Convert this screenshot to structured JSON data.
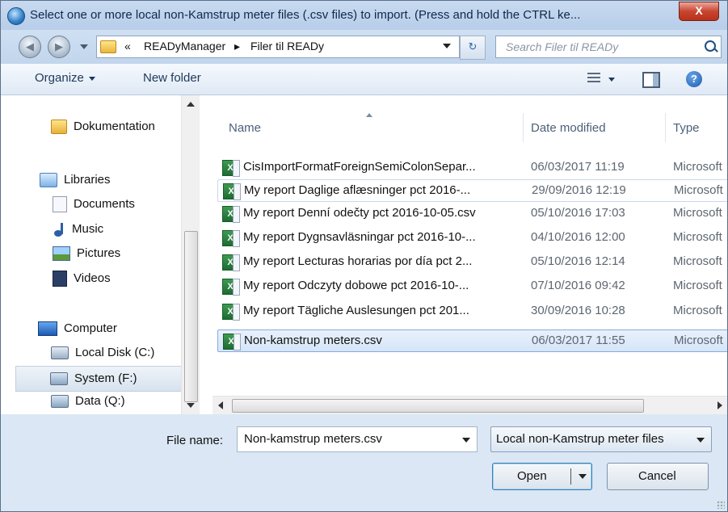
{
  "window": {
    "title": "Select one or more local non-Kamstrup meter files (.csv files) to import. (Press and hold the CTRL ke...",
    "close_glyph": "X"
  },
  "address": {
    "overflow": "«",
    "crumb1": "READyManager",
    "sep": "▸",
    "crumb2": "Filer til READy",
    "refresh_glyph": "↻",
    "search_placeholder": "Search Filer til READy"
  },
  "toolbar": {
    "organize": "Organize",
    "new_folder": "New folder",
    "help_glyph": "?"
  },
  "nav": {
    "items": [
      {
        "label": "Dokumentation",
        "icon": "folder-icon"
      },
      {
        "label": "Libraries",
        "icon": "libraries-icon"
      },
      {
        "label": "Documents",
        "icon": "documents-icon"
      },
      {
        "label": "Music",
        "icon": "music-icon"
      },
      {
        "label": "Pictures",
        "icon": "pictures-icon"
      },
      {
        "label": "Videos",
        "icon": "videos-icon"
      },
      {
        "label": "Computer",
        "icon": "computer-icon"
      },
      {
        "label": "Local Disk (C:)",
        "icon": "local-disk-icon"
      },
      {
        "label": "System (F:)",
        "icon": "network-drive-icon"
      },
      {
        "label": "Data (Q:)",
        "icon": "network-drive-icon"
      }
    ],
    "selected": "System (F:)"
  },
  "columns": {
    "name": "Name",
    "date": "Date modified",
    "type": "Type"
  },
  "files": [
    {
      "name": "CisImportFormatForeignSemiColonSepar...",
      "date": "06/03/2017 11:19",
      "type": "Microsoft",
      "icon": "excel-csv-icon"
    },
    {
      "name": "My report Daglige aflæsninger pct 2016-...",
      "date": "29/09/2016 12:19",
      "type": "Microsoft",
      "icon": "excel-csv-icon"
    },
    {
      "name": "My report Denní odečty pct 2016-10-05.csv",
      "date": "05/10/2016 17:03",
      "type": "Microsoft",
      "icon": "excel-csv-icon"
    },
    {
      "name": "My report Dygnsavläsningar pct 2016-10-...",
      "date": "04/10/2016 12:00",
      "type": "Microsoft",
      "icon": "excel-csv-icon"
    },
    {
      "name": "My report Lecturas horarias por día pct 2...",
      "date": "05/10/2016 12:14",
      "type": "Microsoft",
      "icon": "excel-csv-icon"
    },
    {
      "name": "My report Odczyty dobowe pct 2016-10-...",
      "date": "07/10/2016 09:42",
      "type": "Microsoft",
      "icon": "excel-csv-icon"
    },
    {
      "name": "My report Tägliche Auslesungen pct 201...",
      "date": "30/09/2016 10:28",
      "type": "Microsoft",
      "icon": "excel-csv-icon"
    },
    {
      "name": "Non-kamstrup meters.csv",
      "date": "06/03/2017 11:55",
      "type": "Microsoft",
      "icon": "excel-csv-icon"
    }
  ],
  "selected_file": "Non-kamstrup meters.csv",
  "bottom": {
    "file_name_label": "File name:",
    "file_name_value": "Non-kamstrup meters.csv",
    "file_type_value": "Local non-Kamstrup meter files",
    "open_label": "Open",
    "cancel_label": "Cancel"
  },
  "scroll_glyphs": {
    "vgrip": "≡",
    "hgrip": "III"
  }
}
